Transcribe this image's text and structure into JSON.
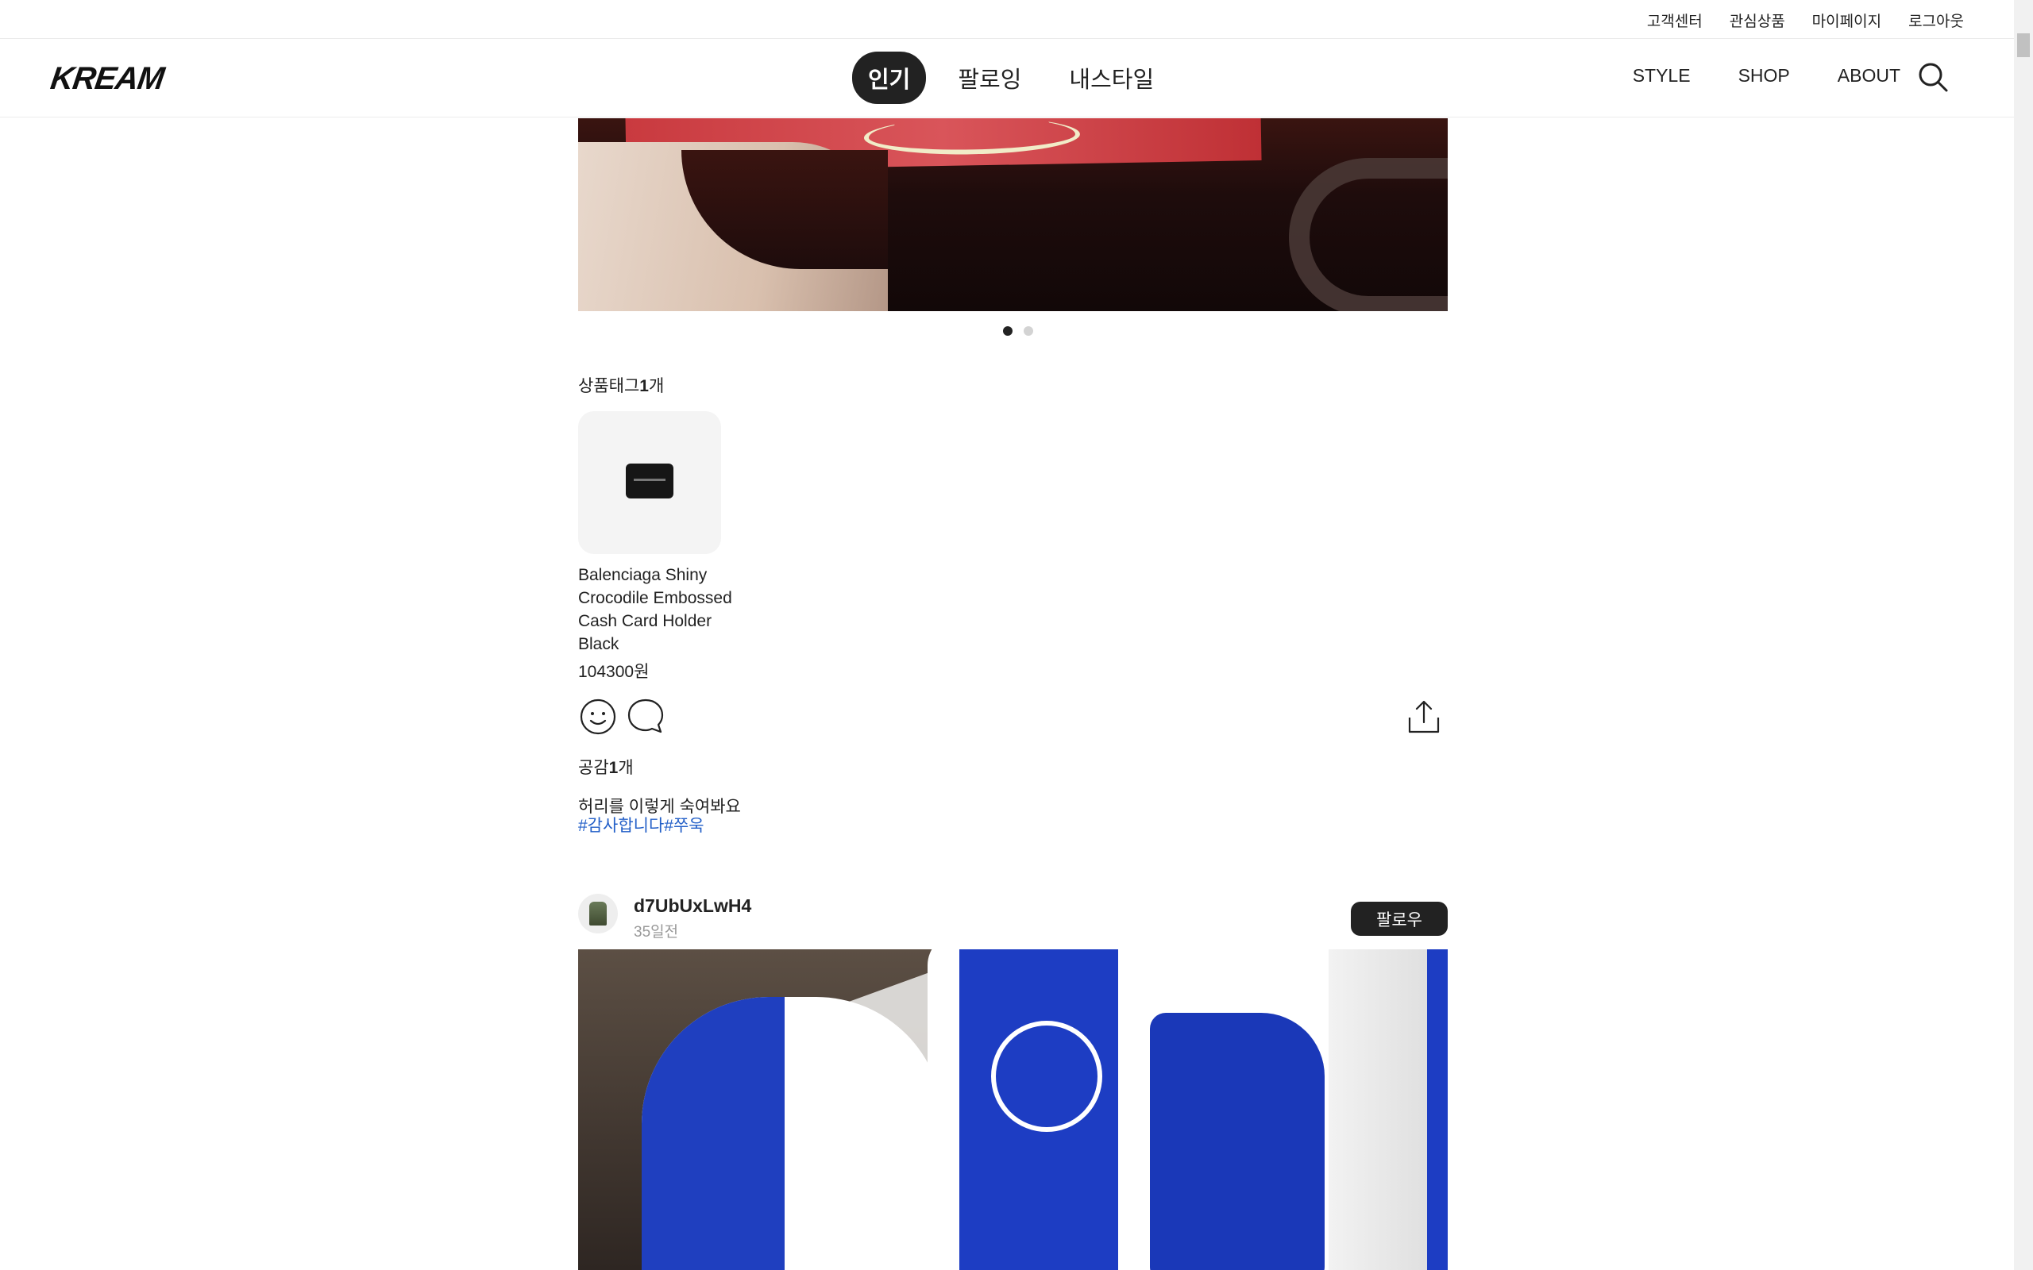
{
  "utility_nav": {
    "items": [
      "고객센터",
      "관심상품",
      "마이페이지",
      "로그아웃"
    ]
  },
  "header": {
    "logo": "KREAM",
    "tabs": [
      {
        "label": "인기",
        "active": true
      },
      {
        "label": "팔로잉",
        "active": false
      },
      {
        "label": "내스타일",
        "active": false
      }
    ],
    "right_nav": [
      "STYLE",
      "SHOP",
      "ABOUT"
    ],
    "search_icon": "search-icon"
  },
  "post1": {
    "carousel": {
      "slides": 2,
      "current": 1
    },
    "product_tag_heading_prefix": "상품태그",
    "product_tag_count": "1",
    "product_tag_heading_suffix": "개",
    "product": {
      "name": "Balenciaga Shiny Crocodile Embossed Cash Card Holder Black",
      "price": "104300원"
    },
    "actions": {
      "empathy_icon": "smiley-icon",
      "comment_icon": "comment-icon",
      "share_icon": "share-icon"
    },
    "likes_prefix": "공감",
    "likes_count": "1",
    "likes_suffix": "개",
    "caption": "허리를 이렇게 숙여봐요",
    "hashtags": [
      "#감사합니다",
      "#쭈욱"
    ]
  },
  "post2": {
    "username": "d7UbUxLwH4",
    "time": "35일전",
    "follow_label": "팔로우"
  },
  "colors": {
    "accent_dark": "#222222",
    "hashtag": "#2460c8"
  }
}
